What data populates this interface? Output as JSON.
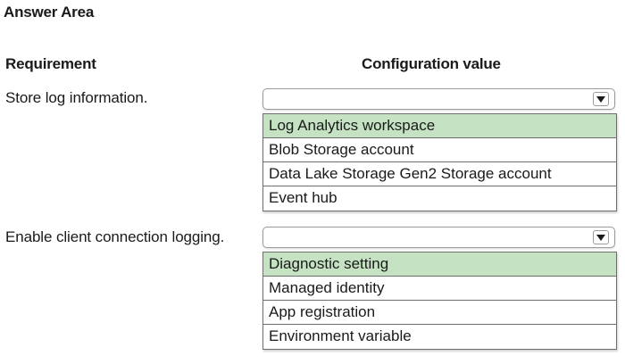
{
  "answer_area": {
    "title": "Answer Area"
  },
  "headers": {
    "requirement": "Requirement",
    "configuration_value": "Configuration value"
  },
  "rows": [
    {
      "requirement": "Store log information.",
      "selected_value": "",
      "options": [
        {
          "label": "Log Analytics workspace",
          "selected": true
        },
        {
          "label": "Blob Storage account",
          "selected": false
        },
        {
          "label": "Data Lake Storage Gen2 Storage account",
          "selected": false
        },
        {
          "label": "Event hub",
          "selected": false
        }
      ]
    },
    {
      "requirement": "Enable client connection logging.",
      "selected_value": "",
      "options": [
        {
          "label": "Diagnostic setting",
          "selected": true
        },
        {
          "label": "Managed identity",
          "selected": false
        },
        {
          "label": "App registration",
          "selected": false
        },
        {
          "label": "Environment variable",
          "selected": false
        }
      ]
    }
  ],
  "colors": {
    "selected_option_bg": "#c5e2c3",
    "border": "#6e6e6e"
  },
  "icons": {
    "dropdown_arrow": "chevron-down-icon"
  }
}
